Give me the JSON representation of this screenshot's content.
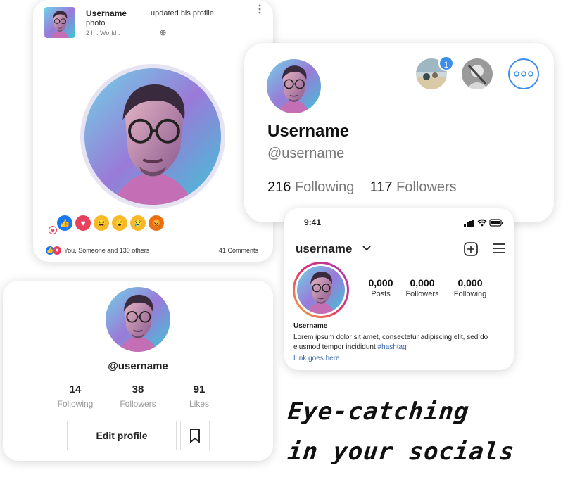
{
  "colors": {
    "accent_blue": "#3d8ee8",
    "like_blue": "#1877f2",
    "love_red": "#e8405f",
    "haha_yellow": "#f7b928",
    "angry_orange": "#e9710f",
    "instagram_gradient": [
      "#f6b13d",
      "#e1306c",
      "#a43cb8"
    ],
    "link_blue": "#3967a8"
  },
  "facebook_card": {
    "username": "Username",
    "action_line1": "updated his profile",
    "action_line2": "photo",
    "meta": "2 h . World .",
    "globe_icon": "globe-icon",
    "reactions": [
      "like",
      "love",
      "haha",
      "wow",
      "sad",
      "angry"
    ],
    "reactors_text": "You, Someone and 130 others",
    "comments_text": "41 Comments"
  },
  "twitter_card": {
    "name": "Username",
    "handle": "@username",
    "following_count": "216",
    "following_label": "Following",
    "followers_count": "117",
    "followers_label": "Followers",
    "notification_count": "1"
  },
  "instagram_card": {
    "time": "9:41",
    "username": "username",
    "stats": [
      {
        "value": "0,000",
        "label": "Posts"
      },
      {
        "value": "0,000",
        "label": "Followers"
      },
      {
        "value": "0,000",
        "label": "Following"
      }
    ],
    "bio_name": "Username",
    "bio_text": "Lorem ipsum dolor sit amet, consectetur adipiscing elit, sed do eiusmod tempor incididunt",
    "hashtag": "#hashtag",
    "link_text": "Link goes here"
  },
  "tiktok_card": {
    "handle": "@username",
    "stats": [
      {
        "value": "14",
        "label": "Following"
      },
      {
        "value": "38",
        "label": "Followers"
      },
      {
        "value": "91",
        "label": "Likes"
      }
    ],
    "edit_label": "Edit profile"
  },
  "tagline": {
    "line1": "Eye-catching",
    "line2": "in your socials"
  }
}
